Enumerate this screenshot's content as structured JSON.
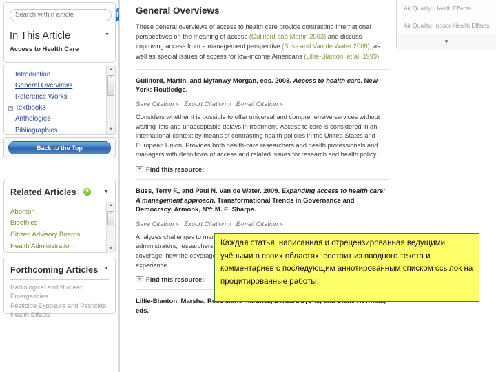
{
  "sidebar": {
    "search": {
      "placeholder": "Search within article",
      "value": "",
      "find_label": "Find"
    },
    "in_this_article": {
      "title": "In This Article",
      "subtitle": "Access to Health Care",
      "caret_icon": "chevron-down-icon",
      "items": [
        {
          "label": "Introduction",
          "active": false,
          "expandable": false
        },
        {
          "label": "General Overviews",
          "active": true,
          "expandable": false
        },
        {
          "label": "Reference Works",
          "active": false,
          "expandable": false
        },
        {
          "label": "Textbooks",
          "active": false,
          "expandable": true
        },
        {
          "label": "Anthologies",
          "active": false,
          "expandable": false
        },
        {
          "label": "Bibliographies",
          "active": false,
          "expandable": false
        }
      ]
    },
    "back_to_top_label": "Back to the Top",
    "related_articles": {
      "title": "Related Articles",
      "help_icon": "help-question-icon",
      "caret_icon": "chevron-down-icon",
      "items": [
        "Abortion",
        "Bioethics",
        "Citizen Advisory Boards",
        "Health Administration"
      ]
    },
    "forthcoming_articles": {
      "title": "Forthcoming Articles",
      "caret_icon": "chevron-down-icon",
      "items": [
        "Radiological and Nuclear Emergencies",
        "Pesticide Exposure and Pesticide Health Effects"
      ]
    }
  },
  "main": {
    "heading": "General Overviews",
    "intro": {
      "part1": "These general overviews of access to health care provide contrasting international perspectives on the meaning of access ",
      "link1": "(Gulliford and Martin 2003)",
      "part2": " and discuss improving access from a management perspective ",
      "link2": "(Buss and Van de Water 2009)",
      "part3": ", as well as special issues of access for low-income Americans ",
      "link3": "(Lillie-Blanton, et al. 1999)",
      "part4": "."
    },
    "entries": [
      {
        "citation_plain1": "Gulliford, Martin, and Myfanwy Morgan, eds. 2003. ",
        "citation_italic": "Access to health care",
        "citation_plain2": ". New York: Routledge.",
        "actions": [
          "Save Citation »",
          "Export Citation »",
          "E-mail Citation »"
        ],
        "annotation": "Considers whether it is possible to offer universal and comprehensive services without waiting lists and unacceptable delays in treatment. Access to care is considered in an international context by means of contrasting health policies in the United States and European Union. Provides both health-care researchers and health professionals and managers with definitions of access and related issues for research and health policy.",
        "find_label": "Find this resource:",
        "find_icon": "expand-plus-icon"
      },
      {
        "citation_plain1": "Buss, Terry F., and Paul N. Van de Water. 2009. ",
        "citation_italic": "Expanding access to health care: A management approach",
        "citation_plain2": ". Transformational Trends in Governance and Democracy. Armonk, NY: M. E. Sharpe.",
        "actions": [
          "Save Citation »",
          "Export Citation »",
          "E-mail Citation »"
        ],
        "annotation": "Analyzes challenges to management of health care from the perspectives of administrators, researchers, and scholars. Describes the current state of access to health coverage, how the coverage gap developed, policy alternatives, and lessons from experience.",
        "find_label": "Find this resource:",
        "find_icon": "expand-plus-icon"
      },
      {
        "citation_plain1": "Lillie-Blanton, Marsha, Rose Marie Martinez, Barbara Lyons, and Diane Rowland, eds.",
        "citation_italic": "",
        "citation_plain2": "",
        "actions": [],
        "annotation": "",
        "find_label": "",
        "find_icon": ""
      }
    ]
  },
  "right_panel": {
    "items": [
      "Air Quality: Health Effects",
      "Air Quality: Indoor Health Effects"
    ],
    "more_icon": "chevron-down-icon"
  },
  "callout": {
    "text": "Каждая статья, написанная и отрецензированная ведущими учёными в своих областях, состоит из вводного текста и комментариев с последующим аннотированным списком ссылок на процитированные работы:",
    "background_color": "#ffff66",
    "border_color": "#3d7a3d"
  },
  "colors": {
    "link_blue": "#2e4b8f",
    "olive": "#6b8e23",
    "citation_green": "#7d9b3a",
    "button_blue": "#2e70bb"
  }
}
